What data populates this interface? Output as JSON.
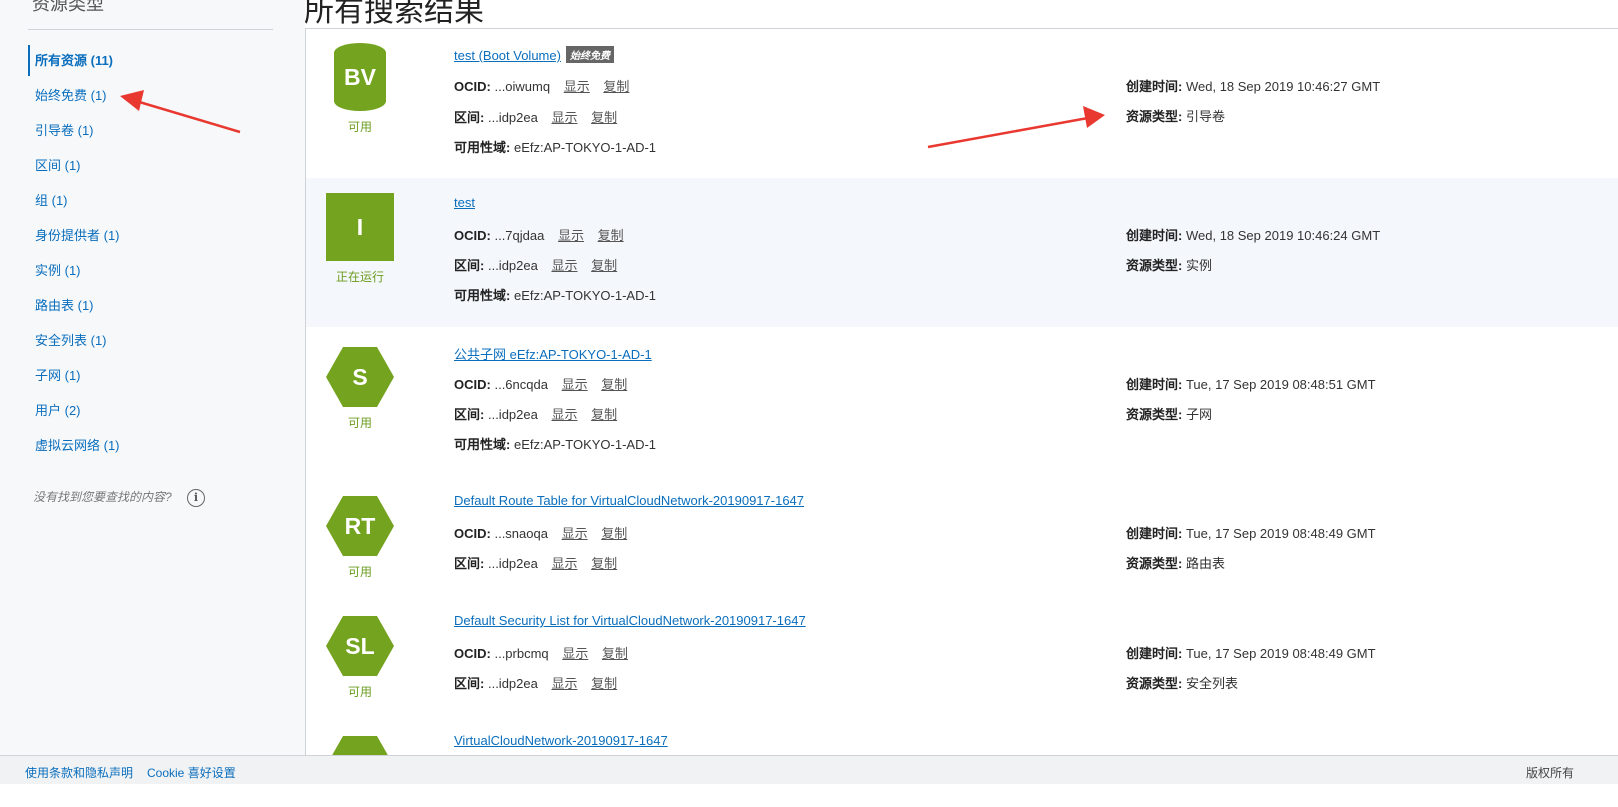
{
  "sidebar": {
    "heading": "资源类型",
    "items": [
      {
        "label": "所有资源 (11)"
      },
      {
        "label": "始终免费 (1)"
      },
      {
        "label": "引导卷 (1)"
      },
      {
        "label": "区间 (1)"
      },
      {
        "label": "组 (1)"
      },
      {
        "label": "身份提供者 (1)"
      },
      {
        "label": "实例 (1)"
      },
      {
        "label": "路由表 (1)"
      },
      {
        "label": "安全列表 (1)"
      },
      {
        "label": "子网 (1)"
      },
      {
        "label": "用户 (2)"
      },
      {
        "label": "虚拟云网络 (1)"
      }
    ],
    "help_text": "没有找到您要查找的内容?",
    "help_icon": "i"
  },
  "main": {
    "title": "所有搜索结果"
  },
  "labels": {
    "ocid": "OCID:",
    "compartment": "区间:",
    "ad": "可用性域:",
    "created": "创建时间:",
    "type": "资源类型:",
    "show": "显示",
    "copy": "复制"
  },
  "results": [
    {
      "badge": "BV",
      "state": "可用",
      "name": "test (Boot Volume)",
      "tag": "始终免费",
      "ocid": "...oiwumq",
      "compartment": "...idp2ea",
      "ad": "eEfz:AP-TOKYO-1-AD-1",
      "created": "Wed, 18 Sep 2019 10:46:27 GMT",
      "type": "引导卷"
    },
    {
      "badge": "I",
      "state": "正在运行",
      "name": "test",
      "ocid": "...7qjdaa",
      "compartment": "...idp2ea",
      "ad": "eEfz:AP-TOKYO-1-AD-1",
      "created": "Wed, 18 Sep 2019 10:46:24 GMT",
      "type": "实例"
    },
    {
      "badge": "S",
      "state": "可用",
      "name": "公共子网 eEfz:AP-TOKYO-1-AD-1",
      "ocid": "...6ncqda",
      "compartment": "...idp2ea",
      "ad": "eEfz:AP-TOKYO-1-AD-1",
      "created": "Tue, 17 Sep 2019 08:48:51 GMT",
      "type": "子网"
    },
    {
      "badge": "RT",
      "state": "可用",
      "name": "Default Route Table for VirtualCloudNetwork-20190917-1647",
      "ocid": "...snaoqa",
      "compartment": "...idp2ea",
      "created": "Tue, 17 Sep 2019 08:48:49 GMT",
      "type": "路由表"
    },
    {
      "badge": "SL",
      "state": "可用",
      "name": "Default Security List for VirtualCloudNetwork-20190917-1647",
      "ocid": "...prbcmq",
      "compartment": "...idp2ea",
      "created": "Tue, 17 Sep 2019 08:48:49 GMT",
      "type": "安全列表"
    },
    {
      "name": "VirtualCloudNetwork-20190917-1647"
    }
  ],
  "footer": {
    "terms": "使用条款和隐私声明",
    "cookie": "Cookie 喜好设置",
    "copyright": "版权所有"
  },
  "colors": {
    "link": "#0a6ebd",
    "badge_green": "#74a320",
    "arrow": "#e8382f"
  }
}
